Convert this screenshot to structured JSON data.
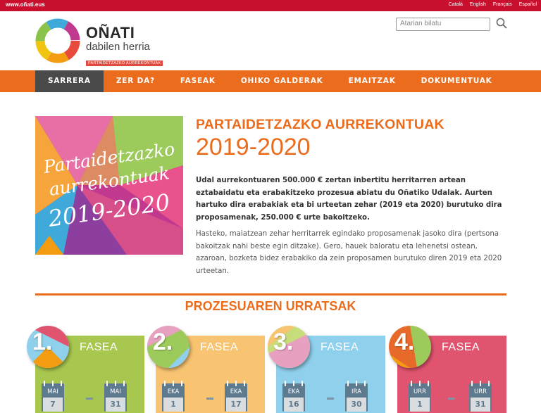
{
  "topbar": {
    "site": "www.oñati.eus",
    "languages": [
      "Català",
      "English",
      "Français",
      "Español"
    ]
  },
  "logo": {
    "title": "OÑATI",
    "subtitle": "dabilen herria",
    "tagline": "PARTAIDETZAZKO AURREKONTUAK"
  },
  "search": {
    "placeholder": "Atarian bilatu"
  },
  "nav": {
    "items": [
      "SARRERA",
      "ZER DA?",
      "FASEAK",
      "OHIKO GALDERAK",
      "EMAITZAK",
      "DOKUMENTUAK"
    ],
    "active_index": 0
  },
  "hero": {
    "line1": "Partaidetzazko",
    "line2": "aurrekontuak",
    "line3": "2019-2020"
  },
  "main": {
    "title": "PARTAIDETZAZKO AURREKONTUAK",
    "year": "2019-2020",
    "intro": "Udal aurrekontuaren 500.000 € zertan inbertitu herritarren artean eztabaidatu eta erabakitzeko prozesua abiatu du Oñatiko Udalak. Aurten hartuko dira erabakiak eta bi urteetan zehar (2019 eta 2020) burutuko dira proposamenak, 250.000 € urte bakoitzeko.",
    "intro2": "Hasteko, maiatzean zehar herritarrek egindako proposamenak jasoko dira (pertsona bakoitzak nahi beste egin ditzake). Gero, hauek baloratu eta lehenetsi ostean, azaroan, bozketa bidez erabakiko da zein proposamen burutuko diren 2019 eta 2020 urteetan."
  },
  "steps": {
    "title": "PROZESUAREN URRATSAK",
    "phases": [
      {
        "num": "1.",
        "label": "FASEA",
        "bg": "#a8c74f",
        "start_month": "MAI",
        "start_day": "7",
        "end_month": "MAI",
        "end_day": "31"
      },
      {
        "num": "2.",
        "label": "FASEA",
        "bg": "#f8c471",
        "start_month": "EKA",
        "start_day": "1",
        "end_month": "EKA",
        "end_day": "17"
      },
      {
        "num": "3.",
        "label": "FASEA",
        "bg": "#8fd0ec",
        "start_month": "EKA",
        "start_day": "16",
        "end_month": "IRA",
        "end_day": "30"
      },
      {
        "num": "4.",
        "label": "FASEA",
        "bg": "#e0546f",
        "start_month": "URR",
        "start_day": "1",
        "end_month": "URR",
        "end_day": "31"
      }
    ]
  }
}
